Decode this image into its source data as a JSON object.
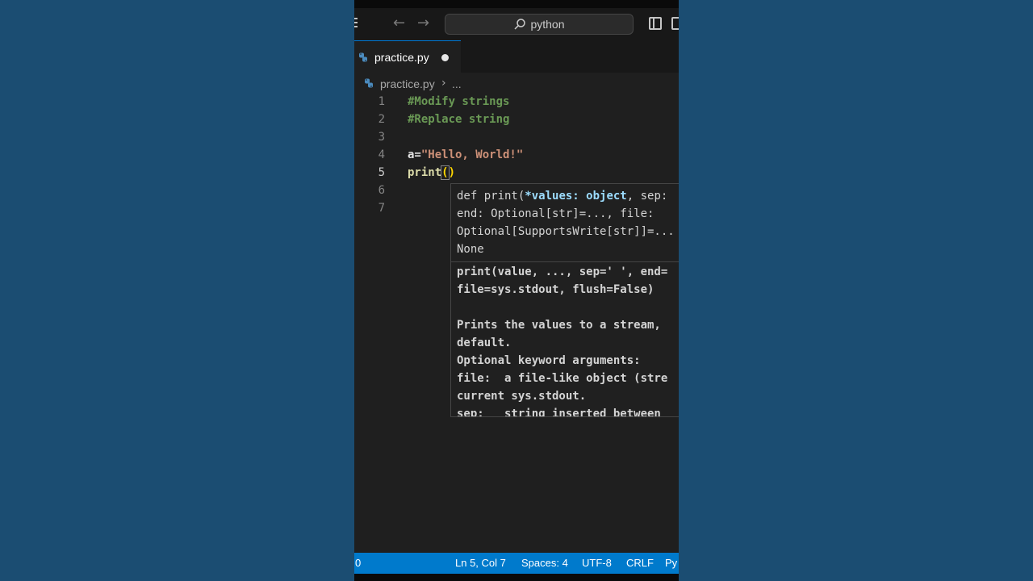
{
  "titlebar": {
    "search_text": "python",
    "back_icon": "arrow-left-icon",
    "forward_icon": "arrow-right-icon"
  },
  "tab": {
    "label": "practice.py",
    "dirty": true
  },
  "breadcrumb": {
    "file": "practice.py",
    "more": "..."
  },
  "editor": {
    "line_numbers": [
      "1",
      "2",
      "3",
      "4",
      "5",
      "6",
      "7"
    ],
    "active_line": 5,
    "lines": {
      "l1": "#Modify strings",
      "l2": "#Replace string",
      "l4_var": "a=",
      "l4_str": "\"Hello, World!\"",
      "l5_fn": "print",
      "l5_open": "(",
      "l5_close": ")"
    }
  },
  "hover": {
    "sig_def": "def print(",
    "sig_param": "*values: object",
    "sig_rest1": ", sep:",
    "sig_line2": "end: Optional[str]=..., file:",
    "sig_line3": "Optional[SupportsWrite[str]]=...",
    "sig_line4": "None",
    "doc_lines": [
      "print(value, ..., sep=' ', end=",
      "file=sys.stdout, flush=False)",
      "",
      "Prints the values to a stream,",
      "default.",
      "Optional keyword arguments:",
      "file:  a file-like object (stre",
      "current sys.stdout.",
      "sep:   string inserted between"
    ]
  },
  "statusbar": {
    "problems": "0",
    "position": "Ln 5, Col 7",
    "indent": "Spaces: 4",
    "encoding": "UTF-8",
    "eol": "CRLF",
    "language": "Py"
  },
  "colors": {
    "statusbar": "#007acc",
    "comment": "#6a9955",
    "string": "#ce9178",
    "function": "#dcdcaa",
    "keyword": "#569cd6"
  }
}
